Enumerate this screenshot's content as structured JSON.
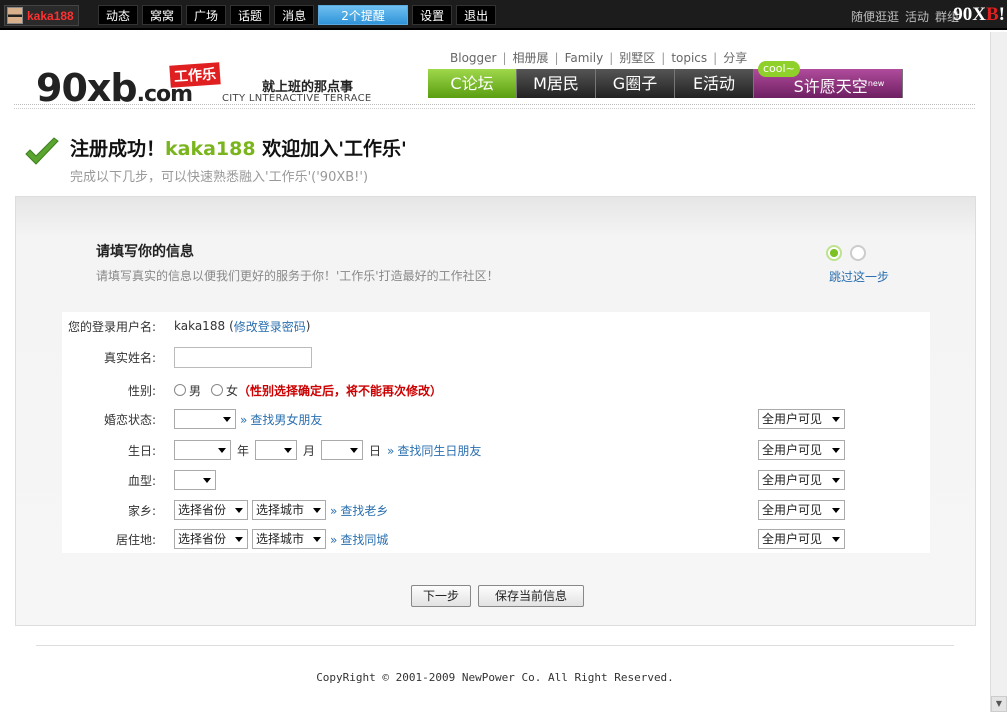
{
  "topbar": {
    "username": "kaka188",
    "nav": [
      "动态",
      "窝窝",
      "广场",
      "话题",
      "消息",
      "2个提醒",
      "设置",
      "退出"
    ],
    "right_links": [
      "随便逛逛",
      "活动",
      "群组"
    ],
    "brand_main": "90X",
    "brand_b": "B",
    "brand_bang": "!"
  },
  "header": {
    "logo_main": "90xb",
    "logo_dot_com": ".com",
    "logo_badge": "工作乐",
    "slogan": "就上班的那点事",
    "slogan_en": "CITY LNTERACTIVE TERRACE",
    "toplinks": [
      "Blogger",
      "相册展",
      "Family",
      "别墅区",
      "topics",
      "分享"
    ],
    "tabs": [
      {
        "label": "C论坛"
      },
      {
        "label": "M居民"
      },
      {
        "label": "G圈子"
      },
      {
        "label": "E活动"
      },
      {
        "label": "S许愿天空",
        "badge": "cool~",
        "sup": "new"
      }
    ]
  },
  "success": {
    "title_prefix": "注册成功！",
    "title_user": "kaka188",
    "title_suffix": " 欢迎加入'工作乐'",
    "subtitle": "完成以下几步，可以快速熟悉融入'工作乐'('90XB!')"
  },
  "panel": {
    "title": "请填写你的信息",
    "desc": "请填写真实的信息以便我们更好的服务于你！'工作乐'打造最好的工作社区！",
    "skip": "跳过这一步"
  },
  "form": {
    "login_label": "您的登录用户名:",
    "login_value": "kaka188",
    "change_pwd_open": "(",
    "change_pwd": "修改登录密码",
    "change_pwd_close": ")",
    "realname_label": "真实姓名:",
    "gender_label": "性别:",
    "gender_male": "男",
    "gender_female": "女",
    "gender_warning": "（性别选择确定后，将不能再次修改）",
    "marital_label": "婚恋状态:",
    "marital_link": "查找男女朋友",
    "birthday_label": "生日:",
    "year_unit": "年",
    "month_unit": "月",
    "day_unit": "日",
    "birthday_link": "查找同生日朋友",
    "blood_label": "血型:",
    "hometown_label": "家乡:",
    "province_select": "选择省份",
    "city_select": "选择城市",
    "hometown_link": "查找老乡",
    "residence_label": "居住地:",
    "residence_link": "查找同城",
    "visibility": "全用户可见",
    "raquo": "»"
  },
  "buttons": {
    "next": "下一步",
    "save": "保存当前信息"
  },
  "footer": {
    "copyright": "CopyRight © 2001-2009 NewPower Co. All Right Reserved."
  },
  "icons": {
    "check": "check-icon",
    "scroll_down": "scroll-down-arrow-icon"
  }
}
